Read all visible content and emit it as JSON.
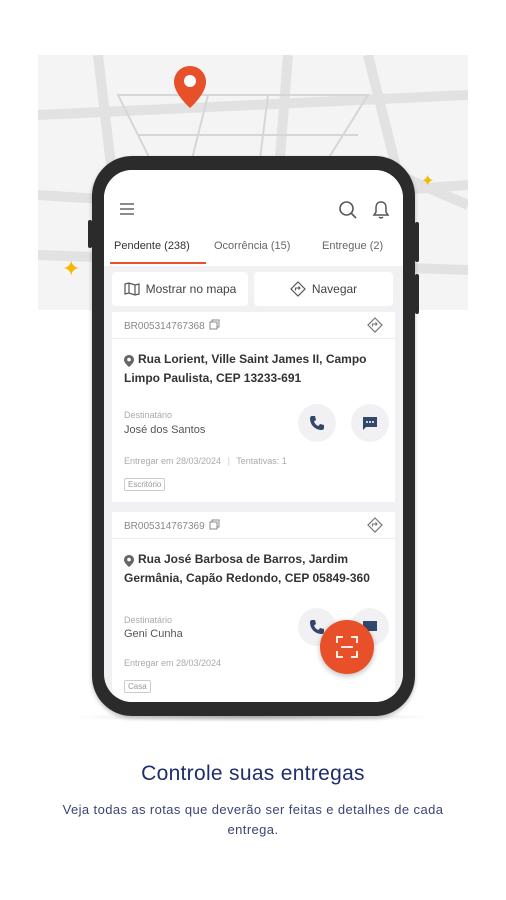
{
  "tabs": [
    {
      "label": "Pendente (238)"
    },
    {
      "label": "Ocorrência (15)"
    },
    {
      "label": "Entregue (2)"
    }
  ],
  "actions": {
    "show_map": "Mostrar no mapa",
    "navigate": "Navegar"
  },
  "deliveries": [
    {
      "id": "BR005314767368",
      "address_line1": "Rua Lorient, Ville Saint James II, Campo",
      "address_line2": "Limpo Paulista, CEP 13233-691",
      "recipient_label": "Destinatário",
      "recipient": "José dos Santos",
      "deliver_on": "Entregar em 28/03/2024",
      "attempts": "Tentativas: 1",
      "tag": "Escritório"
    },
    {
      "id": "BR005314767369",
      "address_line1": "Rua José Barbosa de Barros, Jardim",
      "address_line2": "Germânia, Capão Redondo, CEP 05849-360",
      "recipient_label": "Destinatário",
      "recipient": "Geni Cunha",
      "deliver_on": "Entregar em 28/03/2024",
      "tag": "Casa"
    }
  ],
  "promo": {
    "title": "Controle suas entregas",
    "subtitle": "Veja todas as rotas que deverão ser feitas e detalhes de cada entrega."
  },
  "colors": {
    "accent": "#e8502a",
    "title": "#1f2d6e",
    "sparkle": "#f5b800"
  }
}
